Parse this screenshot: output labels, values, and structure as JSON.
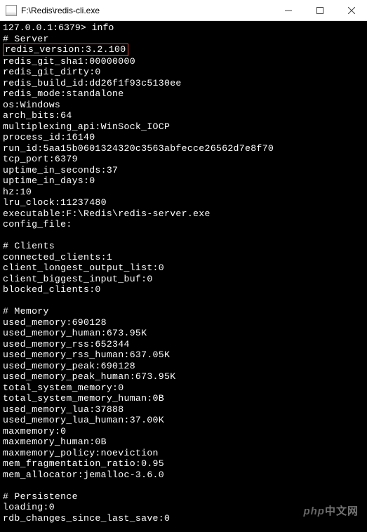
{
  "window": {
    "title": "F:\\Redis\\redis-cli.exe"
  },
  "prompt": {
    "host": "127.0.0.1:6379>",
    "command": "info"
  },
  "sections": {
    "server": {
      "header": "# Server",
      "version": "redis_version:3.2.100",
      "lines": [
        "redis_git_sha1:00000000",
        "redis_git_dirty:0",
        "redis_build_id:dd26f1f93c5130ee",
        "redis_mode:standalone",
        "os:Windows",
        "arch_bits:64",
        "multiplexing_api:WinSock_IOCP",
        "process_id:16140",
        "run_id:5aa15b0601324320c3563abfecce26562d7e8f70",
        "tcp_port:6379",
        "uptime_in_seconds:37",
        "uptime_in_days:0",
        "hz:10",
        "lru_clock:11237480",
        "executable:F:\\Redis\\redis-server.exe",
        "config_file:"
      ]
    },
    "clients": {
      "header": "# Clients",
      "lines": [
        "connected_clients:1",
        "client_longest_output_list:0",
        "client_biggest_input_buf:0",
        "blocked_clients:0"
      ]
    },
    "memory": {
      "header": "# Memory",
      "lines": [
        "used_memory:690128",
        "used_memory_human:673.95K",
        "used_memory_rss:652344",
        "used_memory_rss_human:637.05K",
        "used_memory_peak:690128",
        "used_memory_peak_human:673.95K",
        "total_system_memory:0",
        "total_system_memory_human:0B",
        "used_memory_lua:37888",
        "used_memory_lua_human:37.00K",
        "maxmemory:0",
        "maxmemory_human:0B",
        "maxmemory_policy:noeviction",
        "mem_fragmentation_ratio:0.95",
        "mem_allocator:jemalloc-3.6.0"
      ]
    },
    "persistence": {
      "header": "# Persistence",
      "lines": [
        "loading:0",
        "rdb_changes_since_last_save:0"
      ]
    }
  },
  "watermark": {
    "prefix": "php",
    "suffix": "中文网"
  }
}
